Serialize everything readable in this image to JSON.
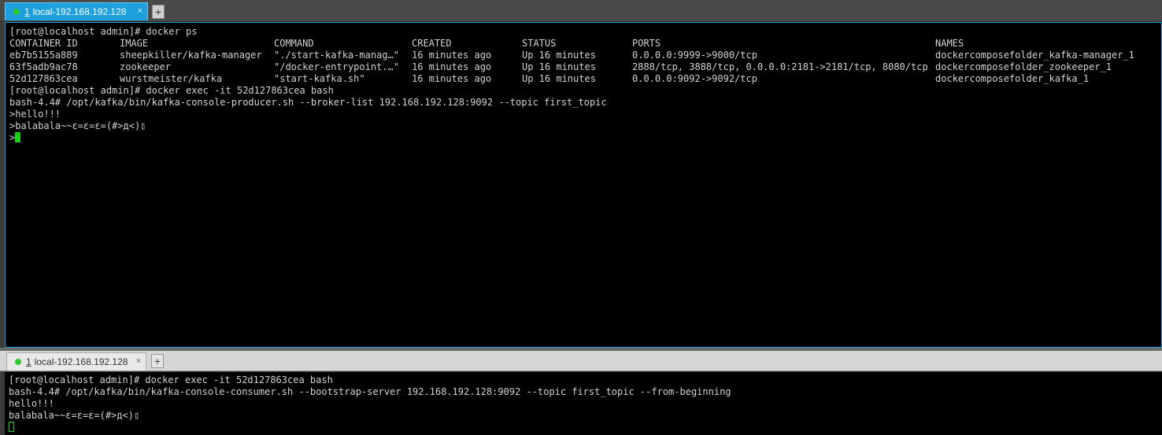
{
  "top_tab": {
    "number": "1",
    "title": "local-192.168.192.128",
    "close": "×",
    "add": "+"
  },
  "bottom_tab": {
    "number": "1",
    "title": "local-192.168.192.128",
    "close": "×",
    "add": "+"
  },
  "top_terminal": {
    "cmd1": "[root@localhost admin]# docker ps",
    "headers": [
      "CONTAINER ID",
      "IMAGE",
      "COMMAND",
      "CREATED",
      "STATUS",
      "PORTS",
      "NAMES"
    ],
    "rows": [
      [
        "eb7b5155a889",
        "sheepkiller/kafka-manager",
        "\"./start-kafka-manag…\"",
        "16 minutes ago",
        "Up 16 minutes",
        "0.0.0.0:9999->9000/tcp",
        "dockercomposefolder_kafka-manager_1"
      ],
      [
        "63f5adb9ac78",
        "zookeeper",
        "\"/docker-entrypoint.…\"",
        "16 minutes ago",
        "Up 16 minutes",
        "2888/tcp, 3888/tcp, 0.0.0.0:2181->2181/tcp, 8080/tcp",
        "dockercomposefolder_zookeeper_1"
      ],
      [
        "52d127863cea",
        "wurstmeister/kafka",
        "\"start-kafka.sh\"",
        "16 minutes ago",
        "Up 16 minutes",
        "0.0.0.0:9092->9092/tcp",
        "dockercomposefolder_kafka_1"
      ]
    ],
    "cmd2": "[root@localhost admin]# docker exec -it 52d127863cea bash",
    "cmd3": "bash-4.4# /opt/kafka/bin/kafka-console-producer.sh --broker-list 192.168.192.128:9092 --topic first_topic",
    "msg1": ">hello!!!",
    "msg2": ">balabala~~ε=ε=ε=(#>д<)▯",
    "prompt": ">"
  },
  "bottom_terminal": {
    "cmd1": "[root@localhost admin]# docker exec -it 52d127863cea bash",
    "cmd2": "bash-4.4# /opt/kafka/bin/kafka-console-consumer.sh --bootstrap-server 192.168.192.128:9092 --topic first_topic --from-beginning",
    "msg1": "hello!!!",
    "msg2": "balabala~~ε=ε=ε=(#>д<)▯"
  },
  "colors": {
    "accent": "#1ea0dc",
    "cursor": "#17d217",
    "status_dot": "#2ec92e"
  }
}
